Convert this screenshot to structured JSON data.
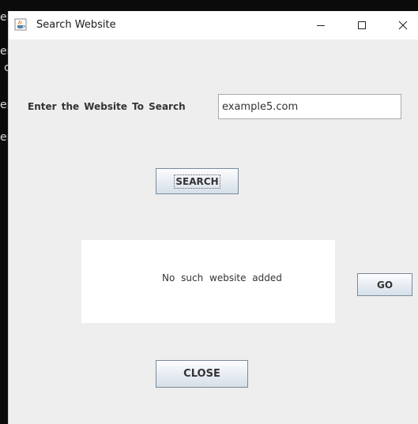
{
  "background": {
    "glyphs": [
      "er",
      "er",
      "c",
      "er",
      "er"
    ]
  },
  "window": {
    "title": "Search Website",
    "controls": {
      "minimize": "—",
      "maximize": "☐",
      "close": "✕"
    }
  },
  "form": {
    "label": "Enter the Website To Search",
    "input_value": "example5.com"
  },
  "buttons": {
    "search": "SEARCH",
    "go": "GO",
    "close": "CLOSE"
  },
  "result": {
    "message": "No such website added"
  },
  "colors": {
    "window_bg": "#eeeeee",
    "titlebar_bg": "#ffffff",
    "button_border": "#7a8a99",
    "desktop_bg": "#0b0b0b"
  },
  "icons": {
    "app": "java-cup-icon"
  }
}
